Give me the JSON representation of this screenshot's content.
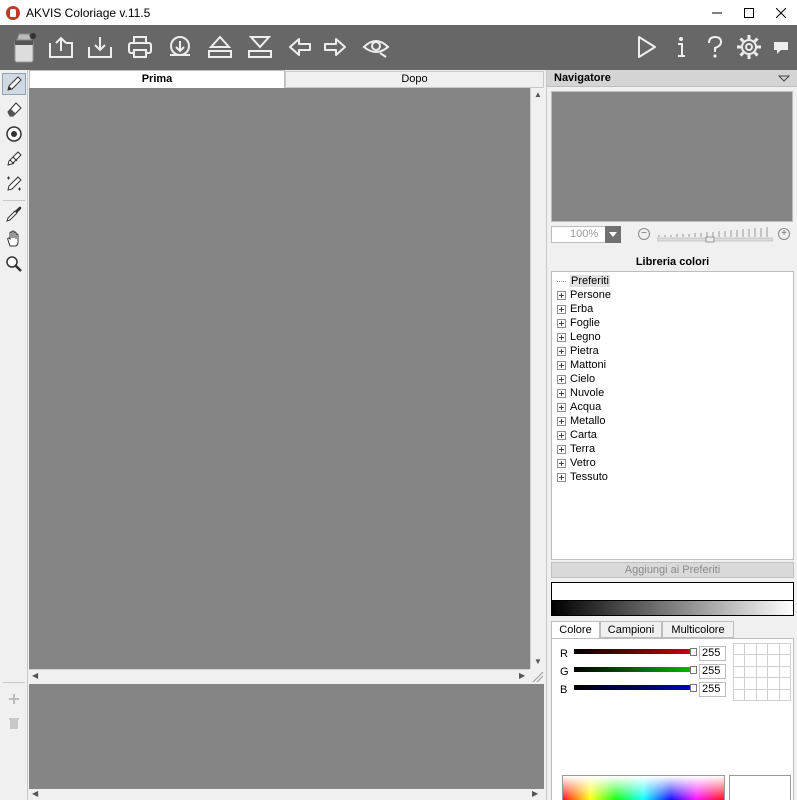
{
  "window": {
    "title": "AKVIS Coloriage v.11.5"
  },
  "toolbar": {
    "icons": [
      "app-logo-icon",
      "open-icon",
      "save-icon",
      "print-icon",
      "share-icon",
      "import-strokes-icon",
      "export-strokes-icon",
      "undo-icon",
      "redo-icon",
      "preview-eye-icon",
      "run-icon",
      "info-icon",
      "help-icon",
      "settings-icon",
      "message-icon"
    ]
  },
  "tools": [
    "pencil-tool-icon",
    "eraser-tool-icon",
    "color-keeper-icon",
    "chain-tool-icon",
    "magic-tube-icon",
    "eyedropper-icon",
    "hand-icon",
    "zoom-icon"
  ],
  "tabs": {
    "before": "Prima",
    "after": "Dopo"
  },
  "navigator": {
    "title": "Navigatore",
    "zoom": "100%"
  },
  "library": {
    "title": "Libreria colori",
    "items": [
      "Preferiti",
      "Persone",
      "Erba",
      "Foglie",
      "Legno",
      "Pietra",
      "Mattoni",
      "Cielo",
      "Nuvole",
      "Acqua",
      "Metallo",
      "Carta",
      "Terra",
      "Vetro",
      "Tessuto"
    ],
    "add_favorites": "Aggiungi ai Preferiti"
  },
  "color": {
    "tabs": [
      "Colore",
      "Campioni",
      "Multicolore"
    ],
    "r_label": "R",
    "g_label": "G",
    "b_label": "B",
    "r": "255",
    "g": "255",
    "b": "255",
    "accent_red": "#d40000",
    "accent_green": "#00c000",
    "accent_blue": "#0000c8"
  },
  "history": {
    "add_icon": "plus-icon",
    "delete_icon": "trash-icon"
  }
}
